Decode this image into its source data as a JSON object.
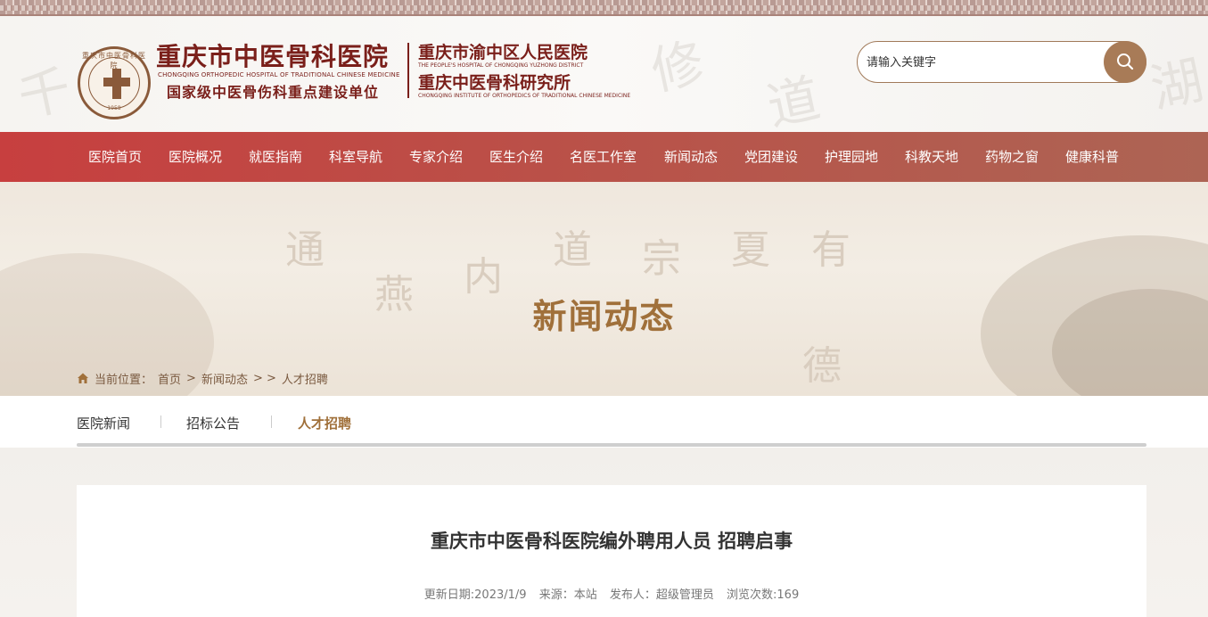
{
  "header": {
    "logo_seal_text": "重庆市中医骨科医院",
    "logo_seal_year": "1958",
    "hospital_name": "重庆市中医骨科医院",
    "hospital_name_en": "CHONGQING ORTHOPEDIC HOSPITAL OF TRADITIONAL CHINESE MEDICINE",
    "hospital_subtitle": "国家级中医骨伤科重点建设单位",
    "hospital2_name": "重庆市渝中区人民医院",
    "hospital2_name_en": "THE PEOPLE'S HOSPITAL OF CHONGQING YUZHONG DISTRICT",
    "hospital3_name": "重庆中医骨科研究所",
    "hospital3_name_en": "CHONGQING INSTITUTE OF ORTHOPEDICS OF TRADITIONAL CHINESE MEDICINE",
    "search_placeholder": "请输入关键字",
    "search_icon": "search-icon"
  },
  "nav": {
    "items": [
      "医院首页",
      "医院概况",
      "就医指南",
      "科室导航",
      "专家介绍",
      "医生介绍",
      "名医工作室",
      "新闻动态",
      "党团建设",
      "护理园地",
      "科教天地",
      "药物之窗",
      "健康科普"
    ]
  },
  "banner": {
    "title": "新闻动态"
  },
  "breadcrumb": {
    "prefix": "当前位置：",
    "home": "首页",
    "sep1": ">",
    "section": "新闻动态",
    "sep2": "> >",
    "current": "人才招聘"
  },
  "subtabs": {
    "items": [
      "医院新闻",
      "招标公告",
      "人才招聘"
    ],
    "active": "人才招聘"
  },
  "article": {
    "title": "重庆市中医骨科医院编外聘用人员 招聘启事",
    "date": "更新日期:2023/1/9",
    "source": "来源：本站",
    "author": "发布人：超级管理员",
    "views": "浏览次数:169"
  },
  "colors": {
    "nav_start": "#c73f3f",
    "nav_end": "#ad6454",
    "brand_dark_red": "#7a1f1a",
    "accent_gold": "#a0703a",
    "search_button": "#a87b57"
  }
}
